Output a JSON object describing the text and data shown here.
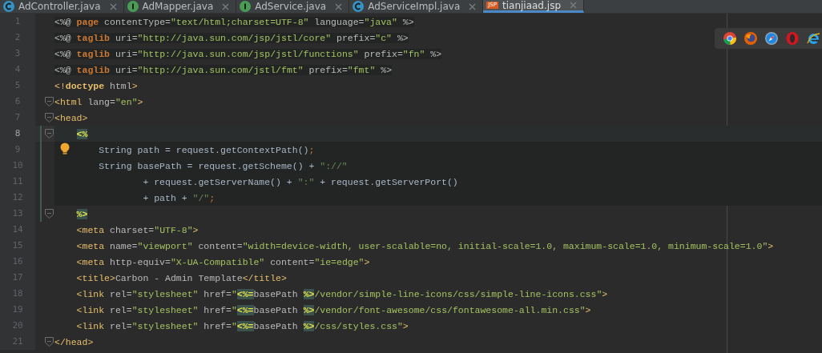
{
  "tabs": [
    {
      "label": "AdController.java",
      "kind": "class",
      "selected": false
    },
    {
      "label": "AdMapper.java",
      "kind": "interface",
      "selected": false
    },
    {
      "label": "AdService.java",
      "kind": "interface",
      "selected": false
    },
    {
      "label": "AdServiceImpl.java",
      "kind": "class",
      "selected": false
    },
    {
      "label": "tianjiaad.jsp",
      "kind": "jsp",
      "badge": "JSP",
      "selected": true
    }
  ],
  "editor": {
    "lines": [
      {
        "number": "1",
        "kind": "directive",
        "current": false,
        "fold": false,
        "hint": false,
        "tokens": [
          {
            "kind": "plain",
            "text": "<%@ "
          },
          {
            "kind": "keyword",
            "text": "page"
          },
          {
            "kind": "attr",
            "text": " contentType="
          },
          {
            "kind": "value",
            "text": "\"text/html;charset=UTF-8\""
          },
          {
            "kind": "attr",
            "text": " language="
          },
          {
            "kind": "value",
            "text": "\"java\""
          },
          {
            "kind": "plain",
            "text": " %>"
          }
        ]
      },
      {
        "number": "2",
        "kind": "directive",
        "current": false,
        "fold": false,
        "hint": false,
        "tokens": [
          {
            "kind": "plain",
            "text": "<%@ "
          },
          {
            "kind": "keyword",
            "text": "taglib"
          },
          {
            "kind": "attr",
            "text": " uri="
          },
          {
            "kind": "value",
            "text": "\"http://java.sun.com/jsp/jstl/core\""
          },
          {
            "kind": "attr",
            "text": " prefix="
          },
          {
            "kind": "value",
            "text": "\"c\""
          },
          {
            "kind": "plain",
            "text": " %>"
          }
        ]
      },
      {
        "number": "3",
        "kind": "directive",
        "current": false,
        "fold": false,
        "hint": false,
        "tokens": [
          {
            "kind": "plain",
            "text": "<%@ "
          },
          {
            "kind": "keyword",
            "text": "taglib"
          },
          {
            "kind": "attr",
            "text": " uri="
          },
          {
            "kind": "value",
            "text": "\"http://java.sun.com/jsp/jstl/functions\""
          },
          {
            "kind": "attr",
            "text": " prefix="
          },
          {
            "kind": "value",
            "text": "\"fn\""
          },
          {
            "kind": "plain",
            "text": " %>"
          }
        ]
      },
      {
        "number": "4",
        "kind": "directive",
        "current": false,
        "fold": false,
        "hint": false,
        "tokens": [
          {
            "kind": "plain",
            "text": "<%@ "
          },
          {
            "kind": "keyword",
            "text": "taglib"
          },
          {
            "kind": "attr",
            "text": " uri="
          },
          {
            "kind": "value",
            "text": "\"http://java.sun.com/jstl/fmt\""
          },
          {
            "kind": "attr",
            "text": " prefix="
          },
          {
            "kind": "value",
            "text": "\"fmt\""
          },
          {
            "kind": "plain",
            "text": " %>"
          }
        ]
      },
      {
        "number": "5",
        "kind": "markup",
        "current": false,
        "fold": false,
        "hint": false,
        "tokens": [
          {
            "kind": "tag",
            "text": "<!"
          },
          {
            "kind": "doctype",
            "text": "doctype"
          },
          {
            "kind": "attr",
            "text": " html"
          },
          {
            "kind": "tag",
            "text": ">"
          }
        ]
      },
      {
        "number": "6",
        "kind": "markup",
        "current": false,
        "fold": true,
        "hint": false,
        "tokens": [
          {
            "kind": "tag",
            "text": "<html"
          },
          {
            "kind": "attr",
            "text": " lang="
          },
          {
            "kind": "value",
            "text": "\"en\""
          },
          {
            "kind": "tag",
            "text": ">"
          }
        ]
      },
      {
        "number": "7",
        "kind": "markup",
        "current": false,
        "fold": true,
        "hint": false,
        "tokens": [
          {
            "kind": "tag",
            "text": "<head>"
          }
        ],
        "children": [
          {
            "number": "8",
            "kind": "scriptlet",
            "current": true,
            "fold": true,
            "hint": false,
            "tokens": [
              {
                "kind": "delim",
                "text": "<%"
              }
            ],
            "children": [
              {
                "number": "9",
                "kind": "scriptlet",
                "current": false,
                "fold": false,
                "hint": true,
                "tokens": [
                  {
                    "kind": "plain",
                    "text": "String path = request.getContextPath()"
                  },
                  {
                    "kind": "punct",
                    "text": ";"
                  }
                ]
              },
              {
                "number": "10",
                "kind": "scriptlet",
                "current": false,
                "fold": false,
                "hint": false,
                "tokens": [
                  {
                    "kind": "plain",
                    "text": "String basePath = request.getScheme() + "
                  },
                  {
                    "kind": "string",
                    "text": "\"://\""
                  }
                ],
                "children": [
                  {
                    "number": "11",
                    "kind": "scriptlet",
                    "current": false,
                    "fold": false,
                    "hint": false,
                    "tokens": [
                      {
                        "kind": "plain",
                        "text": "+ request.getServerName() + "
                      },
                      {
                        "kind": "string",
                        "text": "\":\""
                      },
                      {
                        "kind": "plain",
                        "text": " + request.getServerPort()"
                      }
                    ]
                  },
                  {
                    "number": "12",
                    "kind": "scriptlet",
                    "current": false,
                    "fold": false,
                    "hint": false,
                    "tokens": [
                      {
                        "kind": "plain",
                        "text": "+ path + "
                      },
                      {
                        "kind": "string",
                        "text": "\"/\""
                      },
                      {
                        "kind": "punct",
                        "text": ";"
                      }
                    ]
                  }
                ]
              }
            ]
          },
          {
            "number": "13",
            "kind": "markup",
            "current": false,
            "fold": true,
            "hint": false,
            "tokens": [
              {
                "kind": "delim",
                "text": "%>"
              }
            ]
          },
          {
            "number": "14",
            "kind": "markup",
            "current": false,
            "fold": false,
            "hint": false,
            "tokens": [
              {
                "kind": "tag",
                "text": "<meta"
              },
              {
                "kind": "attr",
                "text": " charset="
              },
              {
                "kind": "value",
                "text": "\"UTF-8\""
              },
              {
                "kind": "tag",
                "text": ">"
              }
            ]
          },
          {
            "number": "15",
            "kind": "markup",
            "current": false,
            "fold": false,
            "hint": false,
            "tokens": [
              {
                "kind": "tag",
                "text": "<meta"
              },
              {
                "kind": "attr",
                "text": " name="
              },
              {
                "kind": "value",
                "text": "\"viewport\""
              },
              {
                "kind": "attr",
                "text": " content="
              },
              {
                "kind": "value",
                "text": "\"width=device-width, user-scalable=no, initial-scale=1.0, maximum-scale=1.0, minimum-scale=1.0\""
              },
              {
                "kind": "tag",
                "text": ">"
              }
            ]
          },
          {
            "number": "16",
            "kind": "markup",
            "current": false,
            "fold": false,
            "hint": false,
            "tokens": [
              {
                "kind": "tag",
                "text": "<meta"
              },
              {
                "kind": "attr",
                "text": " http-equiv="
              },
              {
                "kind": "value",
                "text": "\"X-UA-Compatible\""
              },
              {
                "kind": "attr",
                "text": " content="
              },
              {
                "kind": "value",
                "text": "\"ie=edge\""
              },
              {
                "kind": "tag",
                "text": ">"
              }
            ]
          },
          {
            "number": "17",
            "kind": "markup",
            "current": false,
            "fold": false,
            "hint": false,
            "tokens": [
              {
                "kind": "tag",
                "text": "<title>"
              },
              {
                "kind": "attr",
                "text": "Carbon - Admin Template"
              },
              {
                "kind": "tag",
                "text": "</title>"
              }
            ]
          },
          {
            "number": "18",
            "kind": "markup",
            "current": false,
            "fold": false,
            "hint": false,
            "tokens": [
              {
                "kind": "tag",
                "text": "<link"
              },
              {
                "kind": "attr",
                "text": " rel="
              },
              {
                "kind": "value",
                "text": "\"stylesheet\""
              },
              {
                "kind": "attr",
                "text": " href="
              },
              {
                "kind": "value",
                "text": "\""
              },
              {
                "kind": "delim",
                "text": "<%="
              },
              {
                "kind": "plain",
                "text": "basePath "
              },
              {
                "kind": "delim",
                "text": "%>"
              },
              {
                "kind": "value",
                "text": "/vendor/simple-line-icons/css/simple-line-icons.css\""
              },
              {
                "kind": "tag",
                "text": ">"
              }
            ]
          },
          {
            "number": "19",
            "kind": "markup",
            "current": false,
            "fold": false,
            "hint": false,
            "tokens": [
              {
                "kind": "tag",
                "text": "<link"
              },
              {
                "kind": "attr",
                "text": " rel="
              },
              {
                "kind": "value",
                "text": "\"stylesheet\""
              },
              {
                "kind": "attr",
                "text": " href="
              },
              {
                "kind": "value",
                "text": "\""
              },
              {
                "kind": "delim",
                "text": "<%="
              },
              {
                "kind": "plain",
                "text": "basePath "
              },
              {
                "kind": "delim",
                "text": "%>"
              },
              {
                "kind": "value",
                "text": "/vendor/font-awesome/css/fontawesome-all.min.css\""
              },
              {
                "kind": "tag",
                "text": ">"
              }
            ]
          },
          {
            "number": "20",
            "kind": "markup",
            "current": false,
            "fold": false,
            "hint": false,
            "tokens": [
              {
                "kind": "tag",
                "text": "<link"
              },
              {
                "kind": "attr",
                "text": " rel="
              },
              {
                "kind": "value",
                "text": "\"stylesheet\""
              },
              {
                "kind": "attr",
                "text": " href="
              },
              {
                "kind": "value",
                "text": "\""
              },
              {
                "kind": "delim",
                "text": "<%="
              },
              {
                "kind": "plain",
                "text": "basePath "
              },
              {
                "kind": "delim",
                "text": "%>"
              },
              {
                "kind": "value",
                "text": "/css/styles.css\""
              },
              {
                "kind": "tag",
                "text": ">"
              }
            ]
          }
        ]
      },
      {
        "number": "21",
        "kind": "markup",
        "current": false,
        "fold": true,
        "hint": false,
        "tokens": [
          {
            "kind": "tag",
            "text": "</head>"
          }
        ]
      }
    ]
  }
}
